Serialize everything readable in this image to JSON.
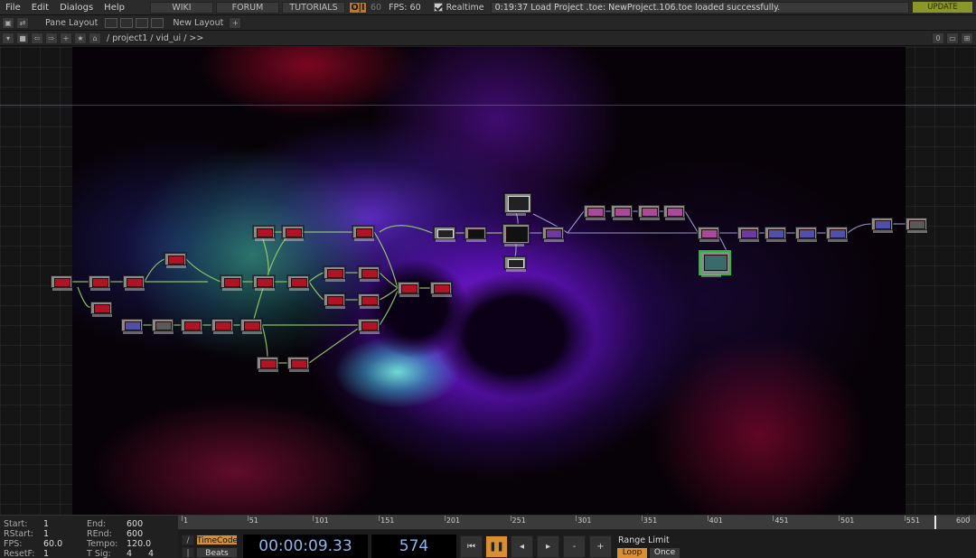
{
  "menu": {
    "file": "File",
    "edit": "Edit",
    "dialogs": "Dialogs",
    "help": "Help"
  },
  "toolbar": {
    "wiki": "WIKI",
    "forum": "FORUM",
    "tutorials": "TUTORIALS",
    "perform_toggle": "O|I",
    "perform_value": "60",
    "fps_label": "FPS:  60",
    "realtime_label": "Realtime",
    "status_message": "0:19:37 Load Project .toe: NewProject.106.toe loaded successfully.",
    "update": "UPDATE"
  },
  "pane_bar": {
    "pane_layout": "Pane Layout",
    "new_layout": "New Layout",
    "add": "+"
  },
  "path_bar": {
    "path": "/ project1 / vid_ui / >>",
    "right_value": "0"
  },
  "timeline": {
    "range": {
      "start_label": "Start:",
      "start": "1",
      "end_label": "End:",
      "end": "600",
      "rstart_label": "RStart:",
      "rstart": "1",
      "rend_label": "REnd:",
      "rend": "600",
      "fps_label": "FPS:",
      "fps": "60.0",
      "tempo_label": "Tempo:",
      "tempo": "120.0",
      "resetf_label": "ResetF:",
      "resetf": "1",
      "tsig_label": "T Sig:",
      "tsig_num": "4",
      "tsig_den": "4"
    },
    "ruler_labels": [
      "1",
      "51",
      "101",
      "151",
      "201",
      "251",
      "301",
      "351",
      "401",
      "451",
      "501",
      "551",
      "600"
    ],
    "current_frame": 574,
    "timecode_btn": "TimeCode",
    "beats_btn": "Beats",
    "timecode": "00:00:09.33",
    "frame": "574",
    "range_limit": "Range Limit",
    "loop": "Loop",
    "once": "Once"
  },
  "icons": {
    "rewind": "rewind-icon",
    "pause": "pause-icon",
    "step_back": "step-back-icon",
    "step_forward": "step-forward-icon",
    "minus": "minus-icon",
    "plus": "plus-icon"
  },
  "colors": {
    "accent": "#d98f30",
    "selected_node": "#1ec03a",
    "update": "#8a9628",
    "timecode_text": "#8eb4e8"
  }
}
